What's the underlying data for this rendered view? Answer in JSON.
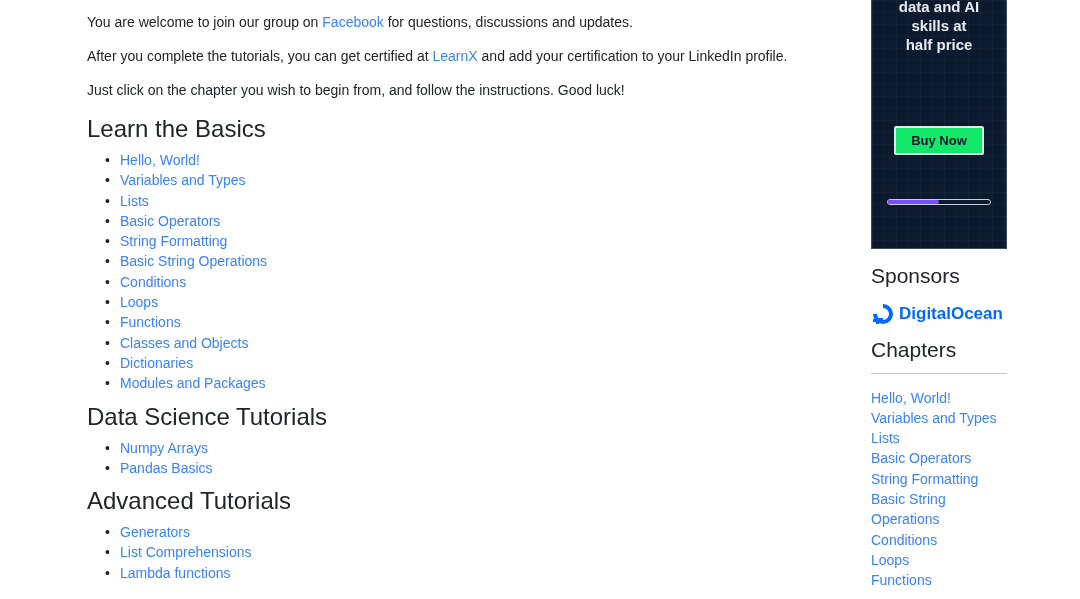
{
  "intro": [
    {
      "before": "You are welcome to join our group on ",
      "link": "Facebook",
      "after": " for questions, discussions and updates."
    },
    {
      "before": "After you complete the tutorials, you can get certified at ",
      "link": "LearnX",
      "after": " and add your certification to your LinkedIn profile."
    },
    {
      "before": "Just click on the chapter you wish to begin from, and follow the instructions. Good luck!"
    }
  ],
  "bullet": "•",
  "sections": [
    {
      "title": "Learn the Basics",
      "items": [
        "Hello, World!",
        "Variables and Types",
        "Lists",
        "Basic Operators",
        "String Formatting",
        "Basic String Operations",
        "Conditions",
        "Loops",
        "Functions",
        "Classes and Objects",
        "Dictionaries",
        "Modules and Packages"
      ]
    },
    {
      "title": "Data Science Tutorials",
      "items": [
        "Numpy Arrays",
        "Pandas Basics"
      ]
    },
    {
      "title": "Advanced Tutorials",
      "items": [
        "Generators",
        "List Comprehensions",
        "Lambda functions"
      ]
    }
  ],
  "ad": {
    "headline": [
      "data and AI",
      "skills at",
      "half price"
    ],
    "button": "Buy Now",
    "level": 0.5
  },
  "sponsors": {
    "title": "Sponsors",
    "sponsor": "DigitalOcean"
  },
  "chapters": {
    "title": "Chapters",
    "items": [
      "Hello, World!",
      "Variables and Types",
      "Lists",
      "Basic Operators",
      "String Formatting",
      "Basic String Operations",
      "Conditions",
      "Loops",
      "Functions"
    ]
  }
}
